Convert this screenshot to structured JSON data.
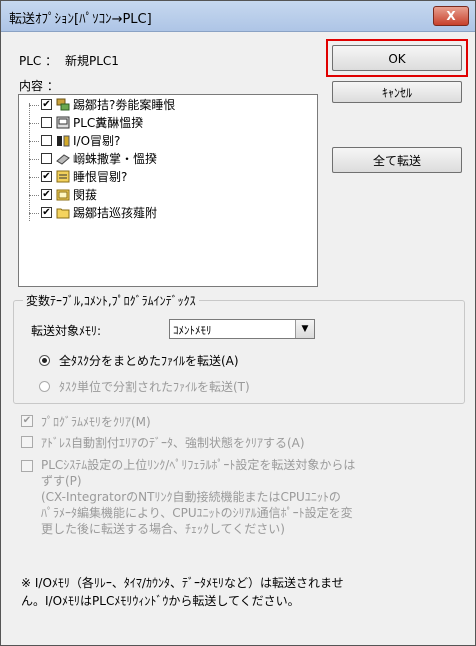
{
  "window": {
    "title": "転送ｵﾌﾟｼｮﾝ[ﾊﾟｿｺﾝ→PLC]",
    "close_symbol": "X"
  },
  "plc": {
    "label": "PLC ：",
    "name": "新規PLC1"
  },
  "contents_label": "内容 ：",
  "tree": {
    "items": [
      {
        "label": "踢鄒拮?劵能案睡恨",
        "checked": true,
        "icon": "network-icon"
      },
      {
        "label": "PLC糞醂慍揆",
        "checked": false,
        "icon": "plc-icon"
      },
      {
        "label": "I/O冒剔?",
        "checked": false,
        "icon": "io-icon"
      },
      {
        "label": "嵶蛛撒掌・慍揆",
        "checked": false,
        "icon": "memory-icon"
      },
      {
        "label": "睡恨冒剔?",
        "checked": true,
        "icon": "symbol-icon"
      },
      {
        "label": "閔菝",
        "checked": true,
        "icon": "folder-icon"
      },
      {
        "label": "踢鄒拮巡孩薤附",
        "checked": true,
        "icon": "folder-icon"
      }
    ]
  },
  "buttons": {
    "ok": "OK",
    "cancel": "ｷｬﾝｾﾙ",
    "transfer_all": "全て転送"
  },
  "variable_group": {
    "title": "変数ﾃｰﾌﾞﾙ,ｺﾒﾝﾄ,ﾌﾟﾛｸﾞﾗﾑｲﾝﾃﾞｯｸｽ",
    "target_label": "転送対象ﾒﾓﾘ:",
    "target_value": "ｺﾒﾝﾄﾒﾓﾘ",
    "radio_all": "全ﾀｽｸ分をまとめたﾌｧｲﾙを転送(A)",
    "radio_task": "ﾀｽｸ単位で分割されたﾌｧｲﾙを転送(T)"
  },
  "options": {
    "clear_program": "ﾌﾟﾛｸﾞﾗﾑﾒﾓﾘをｸﾘｱ(M)",
    "clear_address": "ｱﾄﾞﾚｽ自動割付ｴﾘｱのﾃﾞｰﾀ、強制状態をｸﾘｱする(A)",
    "plc_settings_lines": [
      "PLCｼｽﾃﾑ設定の上位ﾘﾝｸ/ﾍﾟﾘﾌｪﾗﾙﾎﾟｰﾄ設定を転送対象からは",
      "ずす(P)",
      "(CX-IntegratorのNTﾘﾝｸ自動接続機能またはCPUﾕﾆｯﾄの",
      "ﾊﾟﾗﾒｰﾀ編集機能により、CPUﾕﾆｯﾄのｼﾘｱﾙ通信ﾎﾟｰﾄ設定を変",
      "更した後に転送する場合、ﾁｪｯｸしてください)"
    ]
  },
  "note_lines": [
    "※ I/Oﾒﾓﾘ（各ﾘﾚｰ、ﾀｲﾏ/ｶｳﾝﾀ、ﾃﾞｰﾀﾒﾓﾘなど）は転送されませ",
    "ん。I/OﾒﾓﾘはPLCﾒﾓﾘｳｨﾝﾄﾞｳから転送してください。"
  ]
}
